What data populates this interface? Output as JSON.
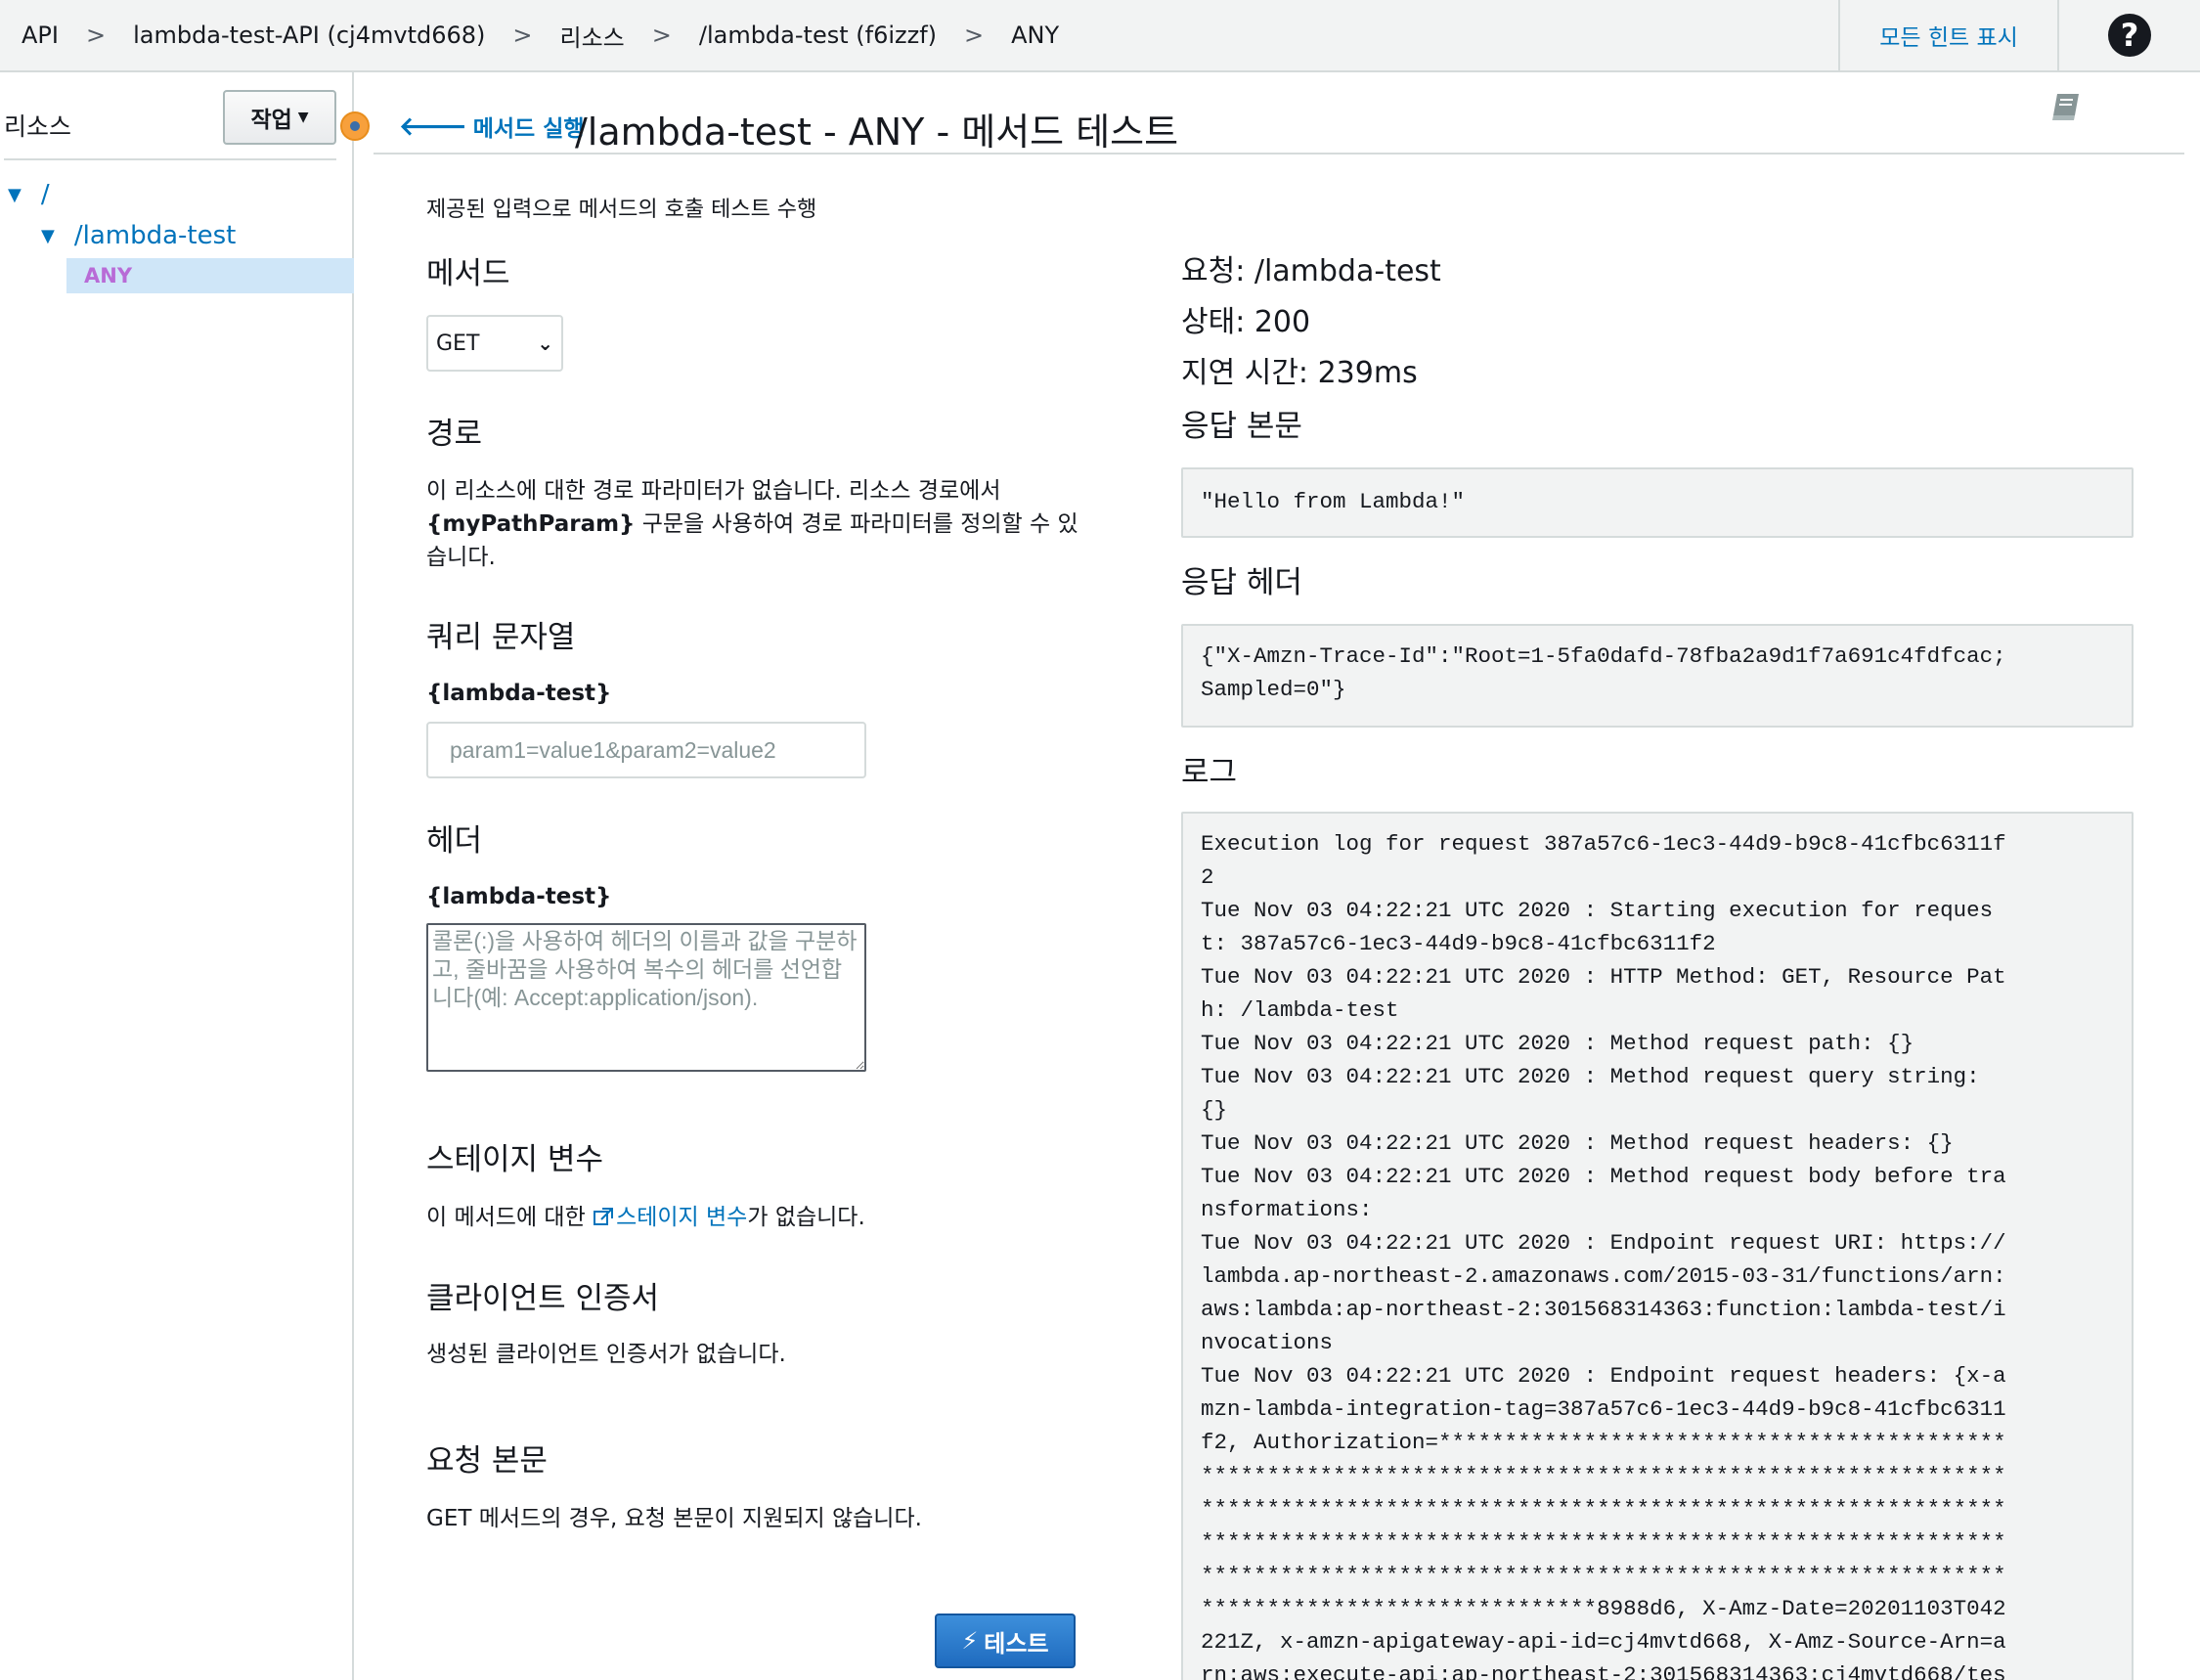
{
  "breadcrumb": {
    "items": [
      "API",
      "lambda-test-API (cj4mvtd668)",
      "리소스",
      "/lambda-test (f6izzf)",
      "ANY"
    ],
    "separator": ">"
  },
  "topbar": {
    "hints_label": "모든 힌트 표시",
    "help_glyph": "?"
  },
  "sidebar": {
    "title": "리소스",
    "actions_label": "작업",
    "tree": {
      "root": "/",
      "child": "/lambda-test",
      "method": "ANY"
    }
  },
  "header": {
    "back_label": "메서드 실행",
    "title": "/lambda-test - ANY - 메서드 테스트"
  },
  "form": {
    "intro": "제공된 입력으로 메서드의 호출 테스트 수행",
    "method_heading": "메서드",
    "method_value": "GET",
    "path_heading": "경로",
    "path_text_line1": "이 리소스에 대한 경로 파라미터가 없습니다. 리소스 경로에서",
    "path_text_bold": "{myPathParam}",
    "path_text_line2_rest": " 구문을 사용하여 경로 파라미터를 정의할 수 있",
    "path_text_line3": "습니다.",
    "query_heading": "쿼리 문자열",
    "query_label": "{lambda-test}",
    "query_placeholder": "param1=value1&param2=value2",
    "headers_heading": "헤더",
    "headers_label": "{lambda-test}",
    "headers_placeholder": "콜론(:)을 사용하여 헤더의 이름과 값을 구분하고, 줄바꿈을 사용하여 복수의 헤더를 선언합니다(예: Accept:application/json).",
    "stage_heading": "스테이지 변수",
    "stage_text_before": "이 메서드에 대한 ",
    "stage_link": "스테이지 변수",
    "stage_text_after": "가 없습니다.",
    "cert_heading": "클라이언트 인증서",
    "cert_text": "생성된 클라이언트 인증서가 없습니다.",
    "body_heading": "요청 본문",
    "body_text": "GET 메서드의 경우, 요청 본문이 지원되지 않습니다.",
    "test_button": "테스트"
  },
  "result": {
    "request_line": "요청: /lambda-test",
    "status_line": "상태: 200",
    "latency_line": "지연 시간: 239ms",
    "response_body_heading": "응답 본문",
    "response_body": "\"Hello from Lambda!\"",
    "response_headers_heading": "응답 헤더",
    "response_headers": "{\"X-Amzn-Trace-Id\":\"Root=1-5fa0dafd-78fba2a9d1f7a691c4fdfcac;\nSampled=0\"}",
    "logs_heading": "로그",
    "logs": "Execution log for request 387a57c6-1ec3-44d9-b9c8-41cfbc6311f\n2\nTue Nov 03 04:22:21 UTC 2020 : Starting execution for reques\nt: 387a57c6-1ec3-44d9-b9c8-41cfbc6311f2\nTue Nov 03 04:22:21 UTC 2020 : HTTP Method: GET, Resource Pat\nh: /lambda-test\nTue Nov 03 04:22:21 UTC 2020 : Method request path: {}\nTue Nov 03 04:22:21 UTC 2020 : Method request query string:\n{}\nTue Nov 03 04:22:21 UTC 2020 : Method request headers: {}\nTue Nov 03 04:22:21 UTC 2020 : Method request body before tra\nnsformations:\nTue Nov 03 04:22:21 UTC 2020 : Endpoint request URI: https://\nlambda.ap-northeast-2.amazonaws.com/2015-03-31/functions/arn:\naws:lambda:ap-northeast-2:301568314363:function:lambda-test/i\nnvocations\nTue Nov 03 04:22:21 UTC 2020 : Endpoint request headers: {x-a\nmzn-lambda-integration-tag=387a57c6-1ec3-44d9-b9c8-41cfbc6311\nf2, Authorization=*******************************************\n*************************************************************\n*************************************************************\n*************************************************************\n*************************************************************\n******************************8988d6, X-Amz-Date=20201103T042\n221Z, x-amzn-apigateway-api-id=cj4mvtd668, X-Amz-Source-Arn=a\nrn:aws:execute-api:ap-northeast-2:301568314363:cj4mvtd668/tes"
  },
  "colors": {
    "link": "#0073bb",
    "topbar_bg": "#f2f3f3",
    "code_bg": "#f2f3f3",
    "selected_bg": "#cfe6f8",
    "method_badge": "#b86bd6",
    "test_button": "#1f6bbf",
    "indicator": "#f7a03c"
  },
  "icons": [
    "chevron-right-icon",
    "help-icon",
    "caret-down-icon",
    "triangle-down-icon",
    "arrow-left-icon",
    "book-icon",
    "external-link-icon",
    "lightning-icon"
  ]
}
